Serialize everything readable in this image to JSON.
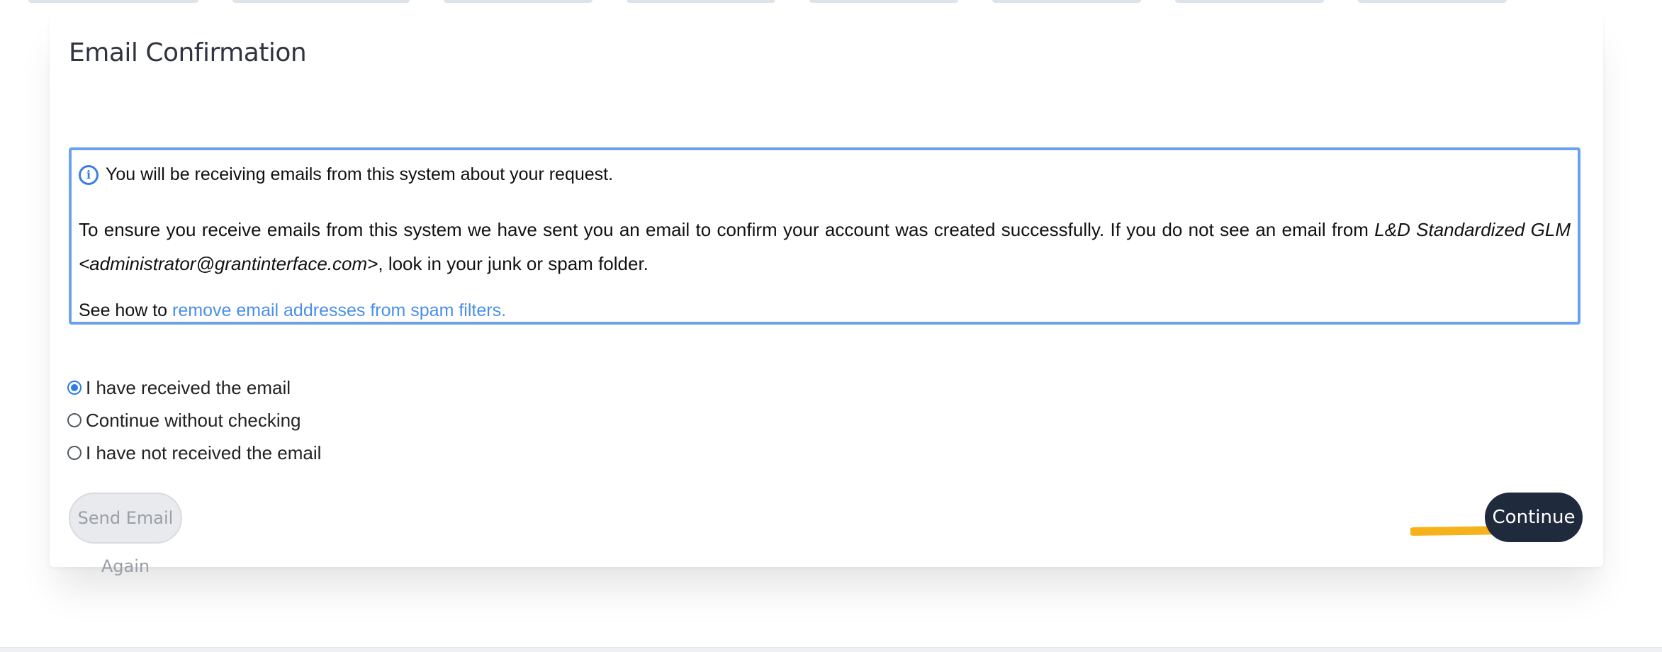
{
  "card": {
    "title": "Email Confirmation"
  },
  "info": {
    "icon": "info-icon",
    "lead": "You will be receiving emails from this system about your request.",
    "para_prefix": "To ensure you receive emails from this system we have sent you an email to confirm your account was created successfully. If you do not see an email from ",
    "para_sender": "L&D Standardized GLM <administrator@grantinterface.com>",
    "para_suffix": ", look in your junk or spam folder.",
    "see_prefix": "See how to ",
    "see_link": "remove email addresses from spam filters."
  },
  "options": {
    "items": [
      {
        "label": "I have received the email",
        "checked": true
      },
      {
        "label": "Continue without checking",
        "checked": false
      },
      {
        "label": "I have not received the email",
        "checked": false
      }
    ]
  },
  "buttons": {
    "send_again": "Send Email Again",
    "continue": "Continue"
  },
  "colors": {
    "info_border": "#6aa1ef",
    "link": "#4a8fe8",
    "continue_bg": "#1f2b3d",
    "arrow": "#f5b21b"
  }
}
